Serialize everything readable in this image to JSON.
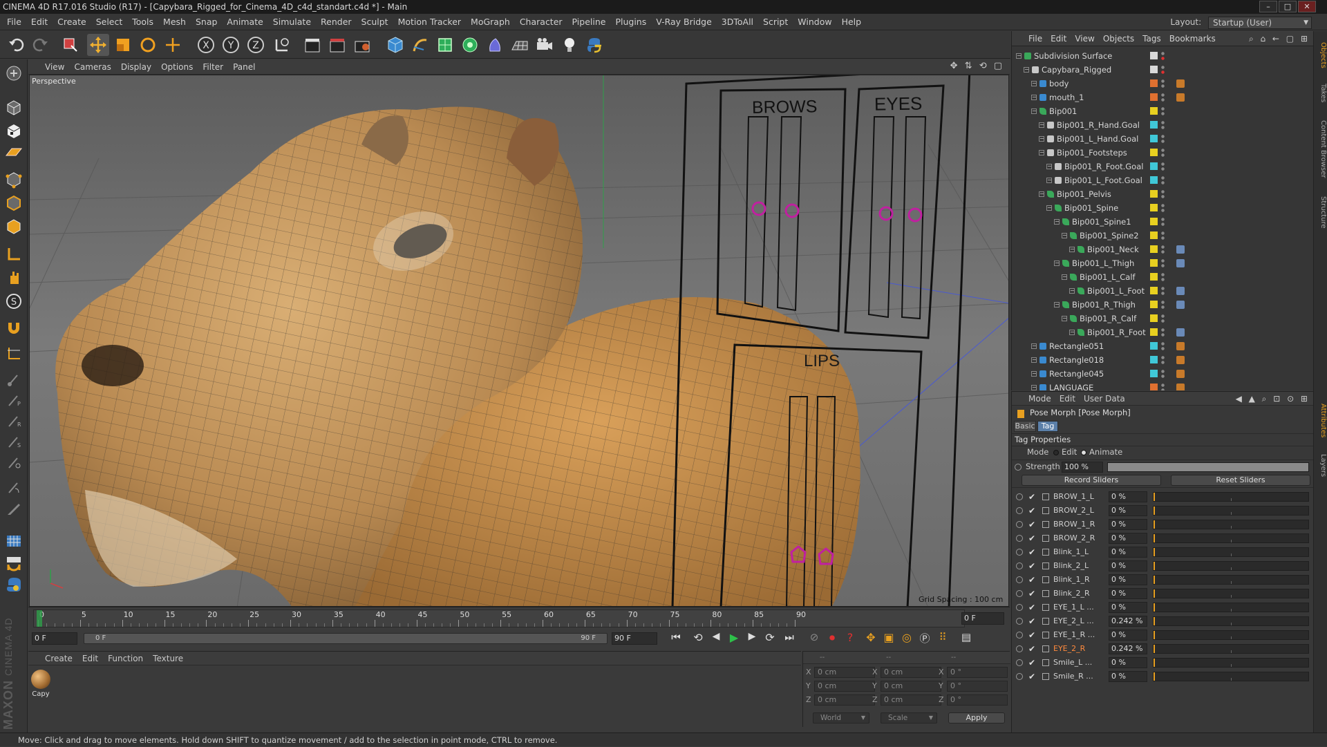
{
  "window": {
    "title": "CINEMA 4D R17.016 Studio (R17) - [Capybara_Rigged_for_Cinema_4D_c4d_standart.c4d *] - Main"
  },
  "menu": [
    "File",
    "Edit",
    "Create",
    "Select",
    "Tools",
    "Mesh",
    "Snap",
    "Animate",
    "Simulate",
    "Render",
    "Sculpt",
    "Motion Tracker",
    "MoGraph",
    "Character",
    "Pipeline",
    "Plugins",
    "V-Ray Bridge",
    "3DToAll",
    "Script",
    "Window",
    "Help"
  ],
  "layout": {
    "label": "Layout:",
    "value": "Startup (User)"
  },
  "viewport": {
    "menu": [
      "View",
      "Cameras",
      "Display",
      "Options",
      "Filter",
      "Panel"
    ],
    "label": "Perspective",
    "grid_spacing": "Grid Spacing : 100 cm",
    "rig_labels": {
      "brows": "BROWS",
      "eyes": "EYES",
      "lips": "LIPS"
    }
  },
  "timeline": {
    "ticks": [
      "0",
      "5",
      "10",
      "15",
      "20",
      "25",
      "30",
      "35",
      "40",
      "45",
      "50",
      "55",
      "60",
      "65",
      "70",
      "75",
      "80",
      "85",
      "90"
    ],
    "frame_field": "0 F",
    "start": "0 F",
    "slider_start": "0 F",
    "slider_end": "90 F",
    "end": "90 F"
  },
  "material": {
    "menu": [
      "Create",
      "Edit",
      "Function",
      "Texture"
    ],
    "items": [
      {
        "name": "Capy"
      }
    ]
  },
  "coordinates": {
    "headers": [
      "--",
      "--",
      "--"
    ],
    "rows": [
      {
        "axis1": "X",
        "v1": "0 cm",
        "axis2": "X",
        "v2": "0 cm",
        "axis3": "X",
        "v3": "0 °"
      },
      {
        "axis1": "Y",
        "v1": "0 cm",
        "axis2": "Y",
        "v2": "0 cm",
        "axis3": "Y",
        "v3": "0 °"
      },
      {
        "axis1": "Z",
        "v1": "0 cm",
        "axis2": "Z",
        "v2": "0 cm",
        "axis3": "Z",
        "v3": "0 °"
      }
    ],
    "mode": "World",
    "scale": "Scale",
    "apply": "Apply"
  },
  "status": "Move: Click and drag to move elements. Hold down SHIFT to quantize movement / add to the selection in point mode, CTRL to remove.",
  "brand": {
    "top": "MAXON",
    "bottom": "CINEMA 4D"
  },
  "object_manager": {
    "menu": [
      "File",
      "Edit",
      "View",
      "Objects",
      "Tags",
      "Bookmarks"
    ],
    "items": [
      {
        "name": "Subdivision Surface",
        "depth": 0,
        "color": "#d9d9d9",
        "type": "subd"
      },
      {
        "name": "Capybara_Rigged",
        "depth": 1,
        "color": "#d9d9d9",
        "type": "null"
      },
      {
        "name": "body",
        "depth": 2,
        "color": "#e07030",
        "type": "mesh"
      },
      {
        "name": "mouth_1",
        "depth": 2,
        "color": "#e07030",
        "type": "mesh"
      },
      {
        "name": "Bip001",
        "depth": 2,
        "color": "#e8d020",
        "type": "bone"
      },
      {
        "name": "Bip001_R_Hand.Goal",
        "depth": 3,
        "color": "#40c8d8",
        "type": "null"
      },
      {
        "name": "Bip001_L_Hand.Goal",
        "depth": 3,
        "color": "#40c8d8",
        "type": "null"
      },
      {
        "name": "Bip001_Footsteps",
        "depth": 3,
        "color": "#e8d020",
        "type": "null"
      },
      {
        "name": "Bip001_R_Foot.Goal",
        "depth": 4,
        "color": "#40c8d8",
        "type": "null"
      },
      {
        "name": "Bip001_L_Foot.Goal",
        "depth": 4,
        "color": "#40c8d8",
        "type": "null"
      },
      {
        "name": "Bip001_Pelvis",
        "depth": 3,
        "color": "#e8d020",
        "type": "bone"
      },
      {
        "name": "Bip001_Spine",
        "depth": 4,
        "color": "#e8d020",
        "type": "bone"
      },
      {
        "name": "Bip001_Spine1",
        "depth": 5,
        "color": "#e8d020",
        "type": "bone"
      },
      {
        "name": "Bip001_Spine2",
        "depth": 6,
        "color": "#e8d020",
        "type": "bone"
      },
      {
        "name": "Bip001_Neck",
        "depth": 7,
        "color": "#e8d020",
        "type": "bone"
      },
      {
        "name": "Bip001_L_Thigh",
        "depth": 5,
        "color": "#e8d020",
        "type": "bone"
      },
      {
        "name": "Bip001_L_Calf",
        "depth": 6,
        "color": "#e8d020",
        "type": "bone"
      },
      {
        "name": "Bip001_L_Foot",
        "depth": 7,
        "color": "#e8d020",
        "type": "bone"
      },
      {
        "name": "Bip001_R_Thigh",
        "depth": 5,
        "color": "#e8d020",
        "type": "bone"
      },
      {
        "name": "Bip001_R_Calf",
        "depth": 6,
        "color": "#e8d020",
        "type": "bone"
      },
      {
        "name": "Bip001_R_Foot",
        "depth": 7,
        "color": "#e8d020",
        "type": "bone"
      },
      {
        "name": "Rectangle051",
        "depth": 2,
        "color": "#40c8d8",
        "type": "mesh"
      },
      {
        "name": "Rectangle018",
        "depth": 2,
        "color": "#40c8d8",
        "type": "mesh"
      },
      {
        "name": "Rectangle045",
        "depth": 2,
        "color": "#40c8d8",
        "type": "mesh"
      },
      {
        "name": "LANGUAGE",
        "depth": 2,
        "color": "#e07030",
        "type": "mesh"
      }
    ]
  },
  "attributes": {
    "menu": [
      "Mode",
      "Edit",
      "User Data"
    ],
    "object_title": "Pose Morph [Pose Morph]",
    "tabs": [
      "Basic",
      "Tag"
    ],
    "active_tab": "Tag",
    "section": "Tag Properties",
    "mode_label": "Mode",
    "mode_options": [
      "Edit",
      "Animate"
    ],
    "mode_selected": "Animate",
    "strength_label": "Strength",
    "strength_value": "100 %",
    "strength_fraction": 1.0,
    "record_button": "Record Sliders",
    "reset_button": "Reset Sliders",
    "sliders": [
      {
        "name": "BROW_1_L",
        "value": "0 %",
        "fraction": 0,
        "highlight": false
      },
      {
        "name": "BROW_2_L",
        "value": "0 %",
        "fraction": 0,
        "highlight": false
      },
      {
        "name": "BROW_1_R",
        "value": "0 %",
        "fraction": 0,
        "highlight": false
      },
      {
        "name": "BROW_2_R",
        "value": "0 %",
        "fraction": 0,
        "highlight": false
      },
      {
        "name": "Blink_1_L",
        "value": "0 %",
        "fraction": 0,
        "highlight": false
      },
      {
        "name": "Blink_2_L",
        "value": "0 %",
        "fraction": 0,
        "highlight": false
      },
      {
        "name": "Blink_1_R",
        "value": "0 %",
        "fraction": 0,
        "highlight": false
      },
      {
        "name": "Blink_2_R",
        "value": "0 %",
        "fraction": 0,
        "highlight": false
      },
      {
        "name": "EYE_1_L ...",
        "value": "0 %",
        "fraction": 0,
        "highlight": false
      },
      {
        "name": "EYE_2_L ...",
        "value": "0.242 %",
        "fraction": 0.00242,
        "highlight": false
      },
      {
        "name": "EYE_1_R ...",
        "value": "0 %",
        "fraction": 0,
        "highlight": false
      },
      {
        "name": "EYE_2_R",
        "value": "0.242 %",
        "fraction": 0.00242,
        "highlight": true
      },
      {
        "name": "Smile_L ...",
        "value": "0 %",
        "fraction": 0,
        "highlight": false
      },
      {
        "name": "Smile_R ...",
        "value": "0 %",
        "fraction": 0,
        "highlight": false
      }
    ]
  },
  "right_tabs": [
    "Objects",
    "Takes",
    "Content Browser",
    "Structure",
    "Attributes",
    "Layers"
  ],
  "colors": {
    "accent": "#e8a020",
    "active_tab": "#5b7fa8",
    "highlight": "#ff8a3d"
  }
}
